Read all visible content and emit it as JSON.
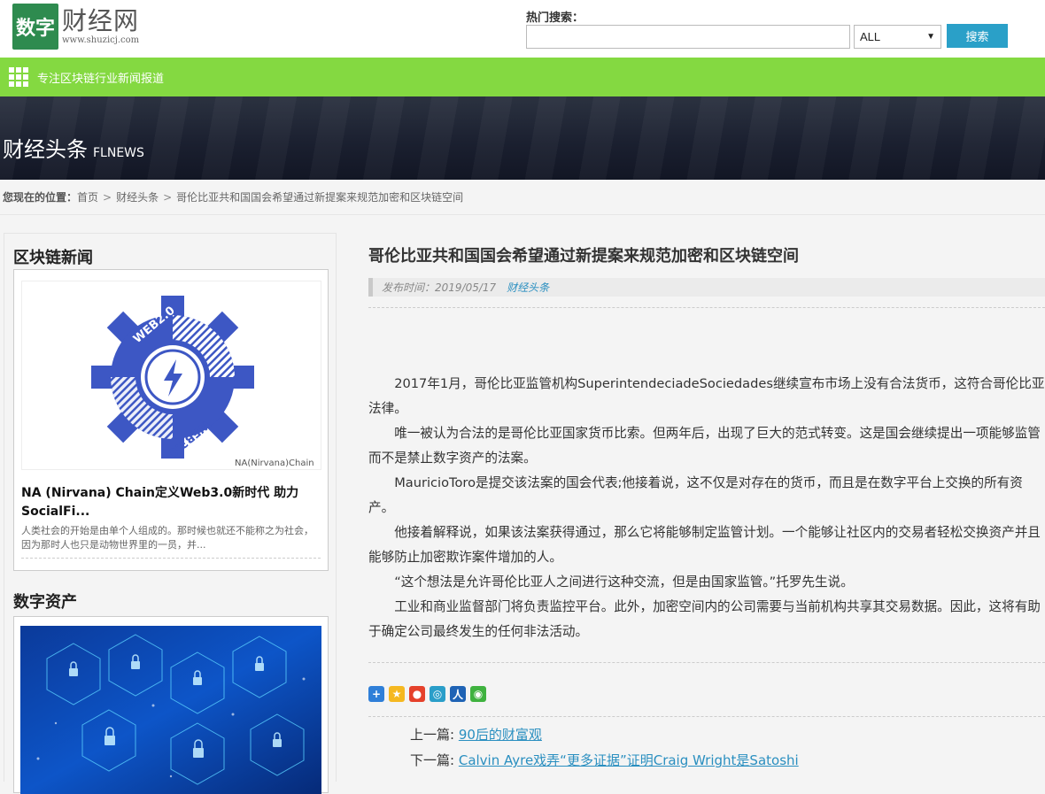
{
  "header": {
    "logo_mark": "数字",
    "logo_name": "财经网",
    "logo_url": "www.shuzicj.com",
    "search_label": "热门搜索：",
    "search_placeholder": "",
    "search_select_value": "ALL",
    "search_button": "搜索"
  },
  "greenbar": {
    "slogan": "专注区块链行业新闻报道"
  },
  "banner": {
    "title_cn": "财经头条",
    "title_en": "FLNEWS"
  },
  "breadcrumb": {
    "lead": "您现在的位置：",
    "items": [
      "首页",
      "财经头条",
      "哥伦比亚共和国国会希望通过新提案来规范加密和区块链空间"
    ],
    "separator": ">"
  },
  "sidebar": {
    "section1_title": "区块链新闻",
    "card1": {
      "image_label_1": "WEB2.0",
      "image_label_2": "WEB3.0",
      "image_caption": "NA(Nirvana)Chain",
      "title": "NA (Nirvana) Chain定义Web3.0新时代 助力SocialFi...",
      "desc": "人类社会的开始是由单个人组成的。那时候也就还不能称之为社会，因为那时人也只是动物世界里的一员，并..."
    },
    "section2_title": "数字资产"
  },
  "article": {
    "title": "哥伦比亚共和国国会希望通过新提案来规范加密和区块链空间",
    "meta_date": "发布时间：2019/05/17",
    "meta_category": "财经头条",
    "paragraphs": [
      "2017年1月，哥伦比亚监管机构SuperintendeciadeSociedades继续宣布市场上没有合法货币，这符合哥伦比亚法律。",
      "唯一被认为合法的是哥伦比亚国家货币比索。但两年后，出现了巨大的范式转变。这是国会继续提出一项能够监管而不是禁止数字资产的法案。",
      "MauricioToro是提交该法案的国会代表;他接着说，这不仅是对存在的货币，而且是在数字平台上交换的所有资产。",
      "他接着解释说，如果该法案获得通过，那么它将能够制定监管计划。一个能够让社区内的交易者轻松交换资产并且能够防止加密欺诈案件增加的人。",
      "“这个想法是允许哥伦比亚人之间进行这种交流，但是由国家监管。”托罗先生说。",
      "工业和商业监督部门将负责监控平台。此外，加密空间内的公司需要与当前机构共享其交易数据。因此，这将有助于确定公司最终发生的任何非法活动。"
    ],
    "prev_label": "上一篇:",
    "prev_link": "90后的财富观",
    "next_label": "下一篇:",
    "next_link": "Calvin Ayre戏弄“更多证据”证明Craig Wright是Satoshi"
  },
  "colors": {
    "green_bar": "#84d941",
    "search_button": "#2aa0c8",
    "link": "#2a8fc0",
    "logo_green": "#2e8b4f"
  }
}
